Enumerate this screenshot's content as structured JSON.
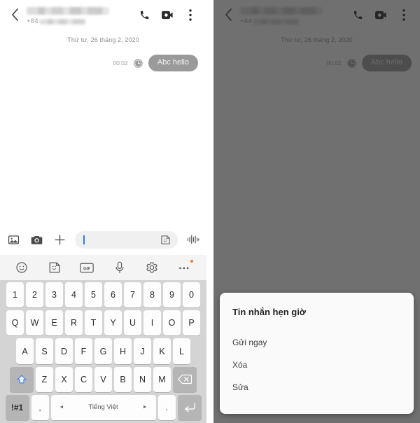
{
  "app": {
    "header": {
      "back_icon": "back-arrow-icon",
      "contact_name": "",
      "country_code": "+84",
      "phone_number": "",
      "call_icon": "phone-icon",
      "video_icon": "video-call-icon",
      "menu_icon": "overflow-menu-icon"
    },
    "thread": {
      "date_separator": "Thứ tư, 26 tháng 2, 2020",
      "messages": [
        {
          "time": "00:02",
          "status_icon": "clock-icon",
          "text": "Abc hello",
          "side": "outgoing"
        }
      ]
    },
    "composer": {
      "gallery_icon": "image-icon",
      "camera_icon": "camera-icon",
      "add_icon": "plus-icon",
      "input_value": "",
      "input_placeholder": "",
      "sticker_icon": "sticker-icon",
      "voice_icon": "audio-waveform-icon"
    },
    "quick_row": {
      "items": [
        {
          "label": "",
          "icon": "emoji-icon"
        },
        {
          "label": "",
          "icon": "sticker-icon"
        },
        {
          "label": "GIF",
          "icon": "gif-icon"
        },
        {
          "label": "",
          "icon": "microphone-icon"
        },
        {
          "label": "",
          "icon": "settings-gear-icon"
        },
        {
          "label": "",
          "icon": "more-options-icon"
        }
      ]
    },
    "keyboard": {
      "row_numbers": [
        "1",
        "2",
        "3",
        "4",
        "5",
        "6",
        "7",
        "8",
        "9",
        "0"
      ],
      "row_q": [
        "Q",
        "W",
        "E",
        "R",
        "T",
        "Y",
        "U",
        "I",
        "O",
        "P"
      ],
      "row_a": [
        "A",
        "S",
        "D",
        "F",
        "G",
        "H",
        "J",
        "K",
        "L"
      ],
      "row_z": [
        "Z",
        "X",
        "C",
        "V",
        "B",
        "N",
        "M"
      ],
      "shift_icon": "shift-arrow-icon",
      "backspace_icon": "backspace-icon",
      "symbols_label": "!#1",
      "comma_label": ",",
      "space_label": "Tiếng Việt",
      "space_prev_icon": "◄",
      "space_next_icon": "►",
      "period_label": ".",
      "enter_icon": "enter-return-icon"
    }
  },
  "dialog": {
    "title": "Tin nhắn hẹn giờ",
    "options": [
      "Gửi ngay",
      "Xóa",
      "Sửa"
    ]
  },
  "colors": {
    "accent": "#2f7de1",
    "bubble": "#9a9a9a",
    "keyboard_bg": "#d4d4d4",
    "badge": "#f3762a",
    "scrim": "#262626"
  }
}
